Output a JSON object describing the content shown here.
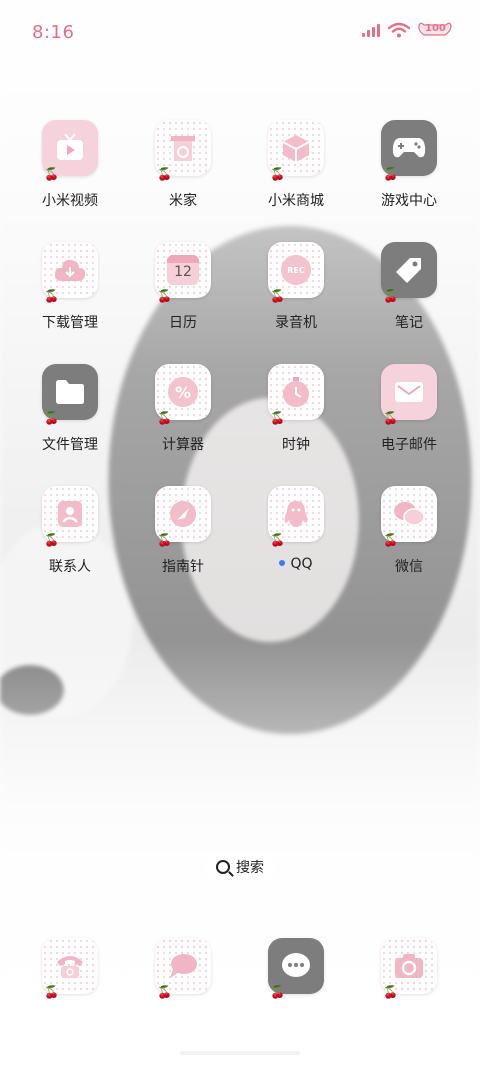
{
  "status_bar": {
    "time": "8:16",
    "battery": "100"
  },
  "apps": [
    {
      "label": "小米视频",
      "icon": "tv-icon"
    },
    {
      "label": "米家",
      "icon": "home-device-icon"
    },
    {
      "label": "小米商城",
      "icon": "gift-box-icon"
    },
    {
      "label": "游戏中心",
      "icon": "gamepad-icon"
    },
    {
      "label": "下载管理",
      "icon": "cloud-download-icon"
    },
    {
      "label": "日历",
      "icon": "calendar-icon",
      "badge": "12"
    },
    {
      "label": "录音机",
      "icon": "recorder-icon",
      "badge": "REC"
    },
    {
      "label": "笔记",
      "icon": "tag-icon"
    },
    {
      "label": "文件管理",
      "icon": "folder-icon"
    },
    {
      "label": "计算器",
      "icon": "calculator-icon"
    },
    {
      "label": "时钟",
      "icon": "stopwatch-icon"
    },
    {
      "label": "电子邮件",
      "icon": "mail-icon"
    },
    {
      "label": "联系人",
      "icon": "contact-icon"
    },
    {
      "label": "指南针",
      "icon": "compass-icon"
    },
    {
      "label": "QQ",
      "icon": "penguin-icon",
      "new_indicator": true
    },
    {
      "label": "微信",
      "icon": "chat-bubbles-icon"
    }
  ],
  "search": {
    "label": "搜索"
  },
  "dock": [
    {
      "icon": "phone-icon"
    },
    {
      "icon": "messages-icon"
    },
    {
      "icon": "more-bubble-icon"
    },
    {
      "icon": "camera-icon"
    }
  ]
}
